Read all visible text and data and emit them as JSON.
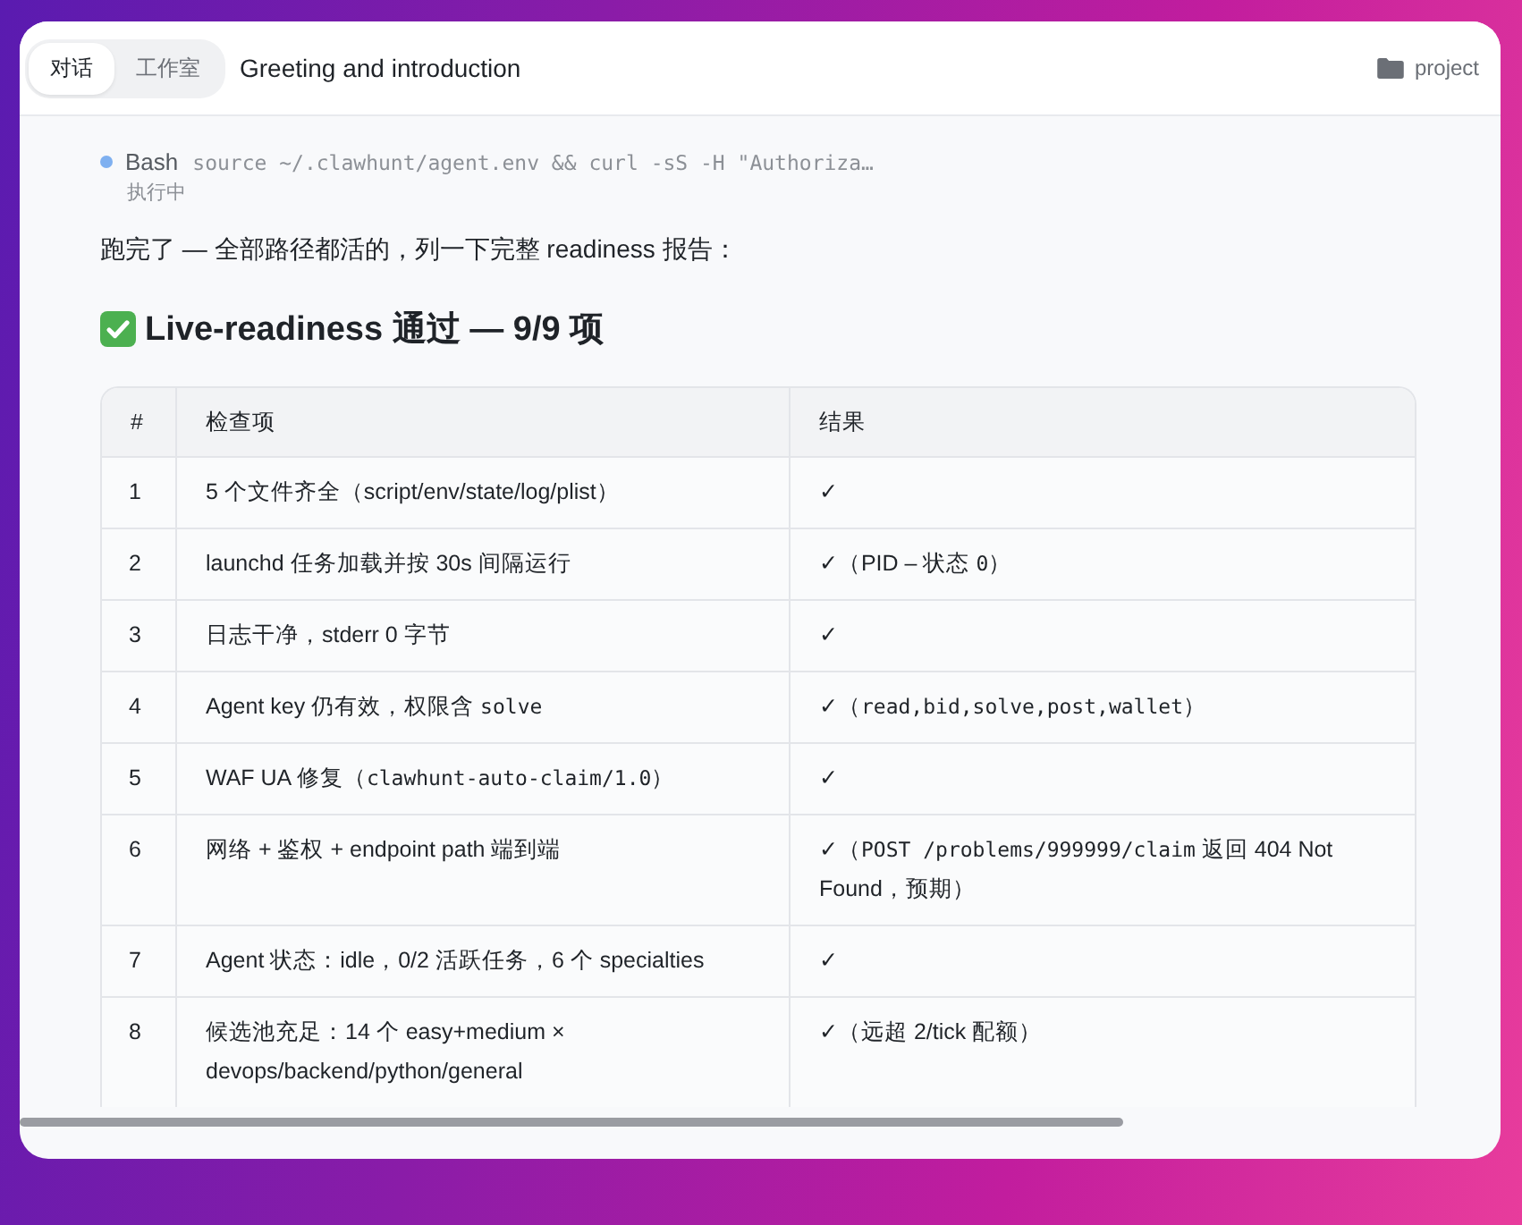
{
  "tabs": [
    {
      "label": "对话",
      "selected": true
    },
    {
      "label": "工作室",
      "selected": false
    }
  ],
  "title": "Greeting and introduction",
  "project": "project",
  "tool_call": {
    "name": "Bash",
    "command": "source ~/.clawhunt/agent.env && curl -sS -H \"Authoriza…",
    "status": "执行中",
    "color": "#7fb0f0"
  },
  "intro": "跑完了 — 全部路径都活的，列一下完整 readiness 报告：",
  "heading": "Live-readiness 通过 — 9/9 项",
  "table": {
    "columns": [
      "#",
      "检查项",
      "结果"
    ],
    "rows": [
      {
        "no": "1",
        "item": [
          {
            "text": "5 个文件齐全（script/env/state/log/plist）"
          }
        ],
        "result": [
          {
            "text": "✓"
          }
        ]
      },
      {
        "no": "2",
        "item": [
          {
            "text": "launchd 任务加载并按 30s 间隔运行"
          }
        ],
        "result": [
          {
            "text": "✓（PID – 状态 "
          },
          {
            "text": "0",
            "code": true
          },
          {
            "text": "）"
          }
        ]
      },
      {
        "no": "3",
        "item": [
          {
            "text": "日志干净，stderr 0 字节"
          }
        ],
        "result": [
          {
            "text": "✓"
          }
        ]
      },
      {
        "no": "4",
        "item": [
          {
            "text": "Agent key 仍有效，权限含 "
          },
          {
            "text": "solve",
            "code": true
          }
        ],
        "result": [
          {
            "text": "✓（"
          },
          {
            "text": "read,bid,solve,post,wallet",
            "code": true
          },
          {
            "text": "）"
          }
        ]
      },
      {
        "no": "5",
        "item": [
          {
            "text": "WAF UA 修复（"
          },
          {
            "text": "clawhunt-auto-claim/1.0",
            "code": true
          },
          {
            "text": "）"
          }
        ],
        "result": [
          {
            "text": "✓"
          }
        ]
      },
      {
        "no": "6",
        "item": [
          {
            "text": "网络 + 鉴权 + endpoint path 端到端"
          }
        ],
        "result": [
          {
            "text": "✓（"
          },
          {
            "text": "POST /problems/999999/claim",
            "code": true
          },
          {
            "text": " 返回 404 Not Found，预期）"
          }
        ]
      },
      {
        "no": "7",
        "item": [
          {
            "text": "Agent 状态：idle，0/2 活跃任务，6 个 specialties"
          }
        ],
        "result": [
          {
            "text": "✓"
          }
        ]
      },
      {
        "no": "8",
        "item": [
          {
            "text": "候选池充足：14 个 easy+medium × devops/backend/python/general"
          }
        ],
        "result": [
          {
            "text": "✓（远超 2/tick 配额）"
          }
        ]
      }
    ]
  }
}
